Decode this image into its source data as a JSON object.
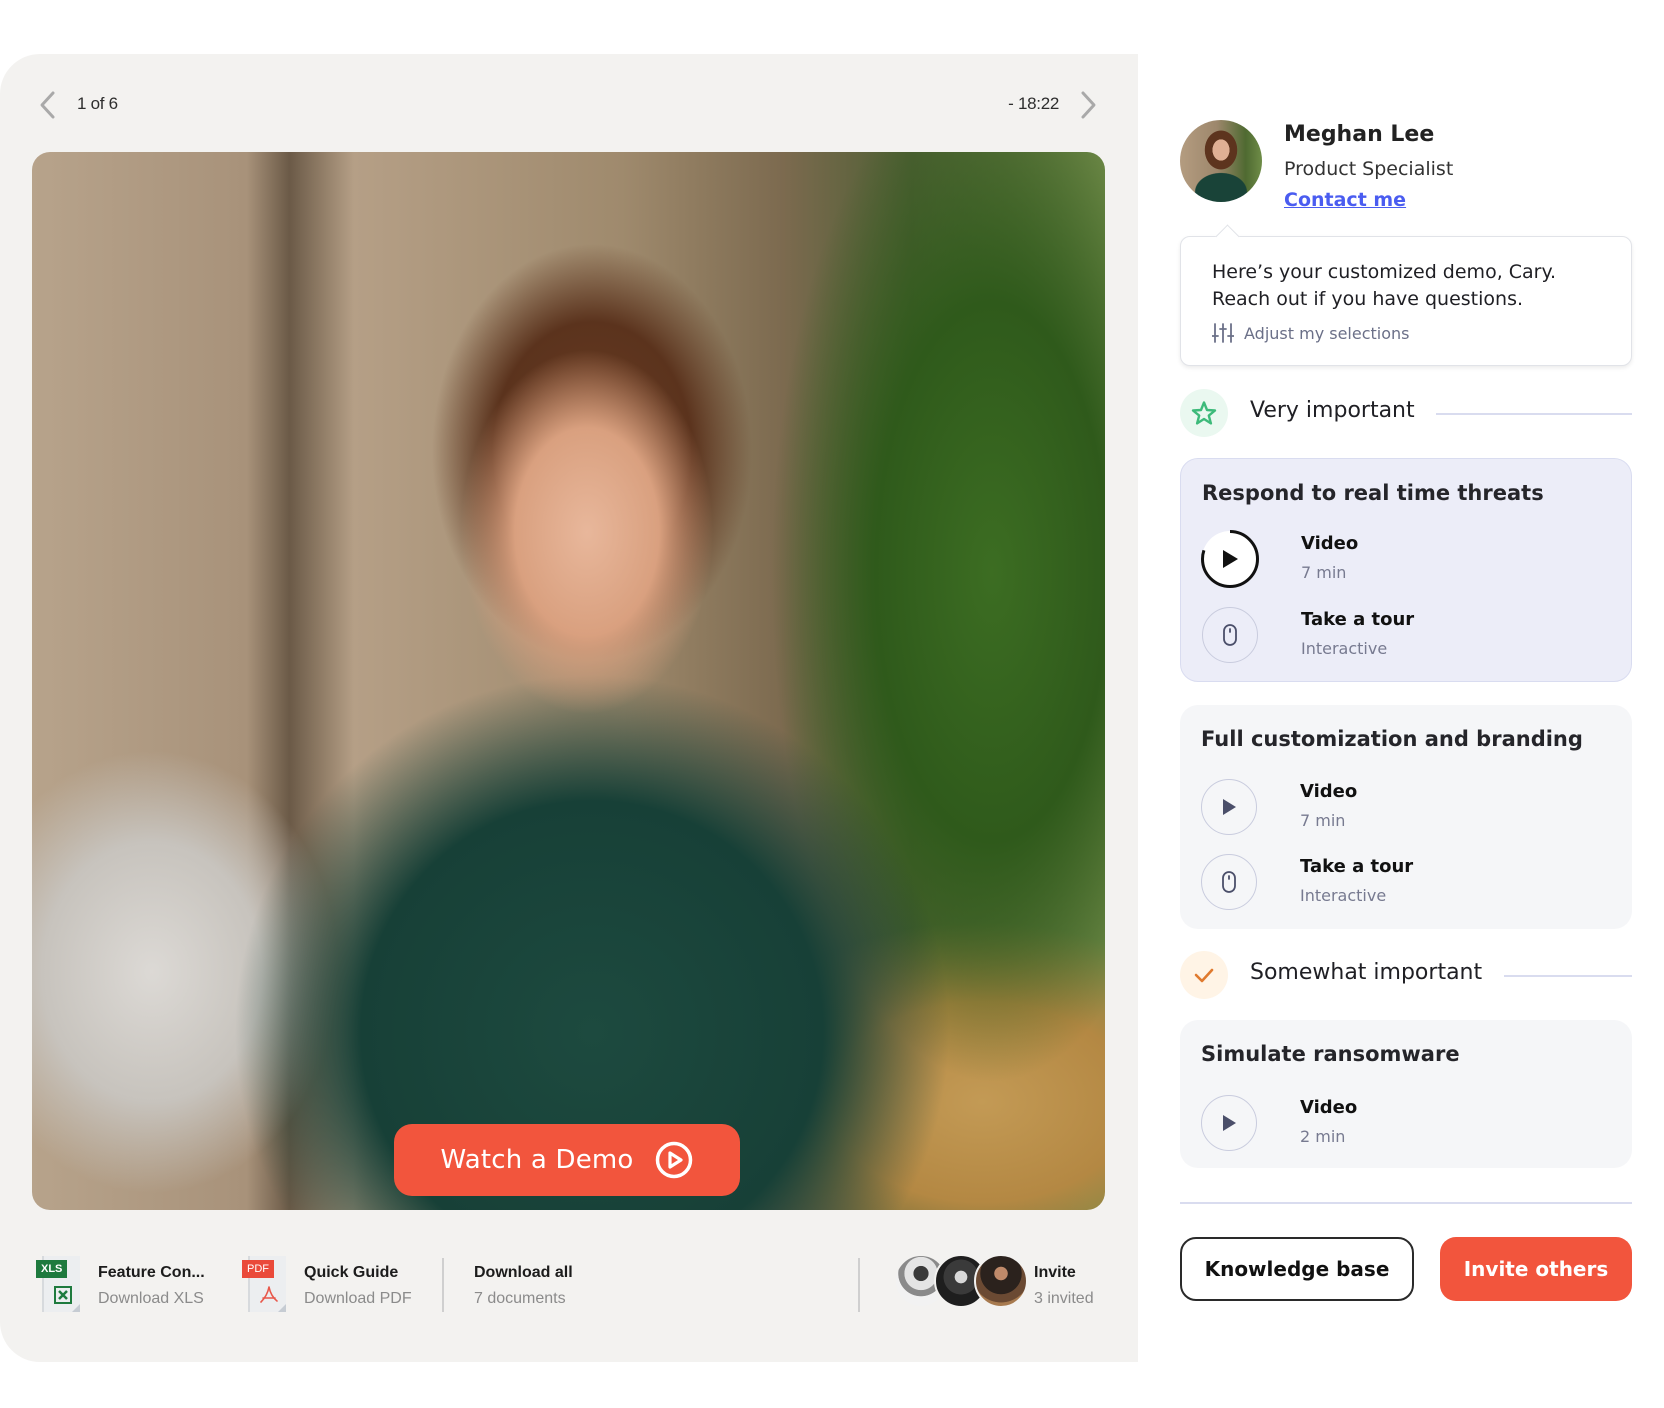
{
  "player": {
    "page_indicator": "1 of 6",
    "time_remaining": "- 18:22",
    "prev_icon": "chevron-left-icon",
    "next_icon": "chevron-right-icon",
    "cta_label": "Watch a Demo",
    "cta_icon": "play-circle-icon",
    "cta_color": "#f2553d",
    "photo_description": "Smiling woman with curly hair in a green blouse, arms crossed, in an office"
  },
  "downloads": {
    "items": [
      {
        "title": "Feature Con...",
        "subtitle": "Download XLS",
        "tag": "XLS",
        "tag_color": "#1e7a3e",
        "icon": "excel-file-icon"
      },
      {
        "title": "Quick Guide",
        "subtitle": "Download PDF",
        "tag": "PDF",
        "tag_color": "#ea4a3a",
        "icon": "pdf-file-icon"
      }
    ],
    "download_all": {
      "title": "Download all",
      "subtitle": "7 documents"
    },
    "invite": {
      "title": "Invite",
      "subtitle": "3 invited",
      "avatar_count": 3
    }
  },
  "profile": {
    "name": "Meghan Lee",
    "role": "Product Specialist",
    "contact_label": "Contact me",
    "link_color": "#4a5cf0"
  },
  "message": {
    "text": "Here’s your customized demo, Cary. Reach out if you have questions.",
    "adjust_label": "Adjust my selections",
    "adjust_icon": "sliders-icon"
  },
  "sections": [
    {
      "label": "Very important",
      "icon": "star-icon",
      "icon_color": "#3dba7a",
      "badge_bg": "#eaf8f0",
      "topics": [
        {
          "title": "Respond to real time threats",
          "active": true,
          "resources": [
            {
              "type": "video",
              "title": "Video",
              "subtitle": "7 min",
              "icon": "play-icon",
              "progress": 0.8
            },
            {
              "type": "tour",
              "title": "Take a tour",
              "subtitle": "Interactive",
              "icon": "mouse-icon"
            }
          ]
        },
        {
          "title": "Full customization and branding",
          "active": false,
          "resources": [
            {
              "type": "video",
              "title": "Video",
              "subtitle": "7 min",
              "icon": "play-icon"
            },
            {
              "type": "tour",
              "title": "Take a tour",
              "subtitle": "Interactive",
              "icon": "mouse-icon"
            }
          ]
        }
      ]
    },
    {
      "label": "Somewhat important",
      "icon": "check-icon",
      "icon_color": "#e07a2e",
      "badge_bg": "#fff4e6",
      "topics": [
        {
          "title": "Simulate ransomware",
          "active": false,
          "resources": [
            {
              "type": "video",
              "title": "Video",
              "subtitle": "2 min",
              "icon": "play-icon"
            }
          ]
        }
      ]
    }
  ],
  "actions": {
    "knowledge_base_label": "Knowledge base",
    "invite_label": "Invite others",
    "accent_color": "#f2553d"
  }
}
